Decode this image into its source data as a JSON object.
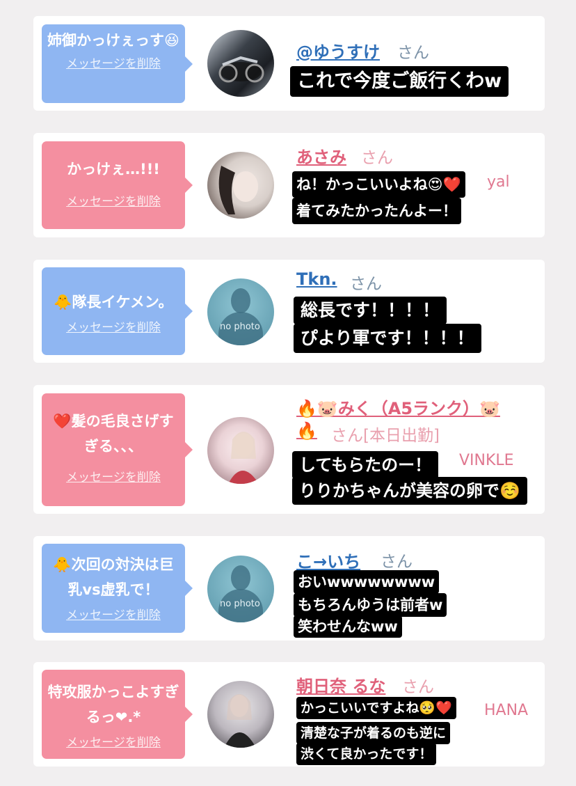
{
  "delete_label": "メッセージを削除",
  "no_photo": "no photo",
  "cards": [
    {
      "message": "姉御かっけぇっす😆",
      "name": "@ゆうすけ",
      "honorific": "さん",
      "captions": [
        "これで今度ご飯行くわw"
      ]
    },
    {
      "message": "かっけぇ…!!!",
      "name": "あさみ",
      "honorific": "さん",
      "hidden_sub": "yal",
      "captions": [
        "ね！かっこいいよね😍❤️",
        "着てみたかったんよー！"
      ]
    },
    {
      "message": "🐥隊長イケメン。",
      "name": "Tkn.",
      "honorific": "さん",
      "captions": [
        "総長です！！！！",
        "ぴより軍です！！！！"
      ]
    },
    {
      "message": "❤️髪の毛良さげすぎる、、、",
      "name_line1": "🔥🐷みく（A5ランク）🐷",
      "name_line2": "🔥",
      "honorific": "さん[本日出勤]",
      "hidden_sub": "VINKLE",
      "captions": [
        "してもらたのー！",
        "りりかちゃんが美容の卵で☺️"
      ]
    },
    {
      "message": "🐥次回の対決は巨乳vs虚乳で！",
      "name": "こ→いち",
      "honorific": "さん",
      "captions": [
        "おいwwwwwwww",
        "もちろんゆうは前者w",
        "笑わせんなww"
      ]
    },
    {
      "message": "特攻服かっこよすぎるっ❤︎.*",
      "name": "朝日奈 るな",
      "honorific": "さん",
      "hidden_sub": "HANA",
      "captions": [
        "かっこいいですよね🥺❤️",
        "清楚な子が着るのも逆に",
        "渋くて良かったです！"
      ]
    }
  ]
}
